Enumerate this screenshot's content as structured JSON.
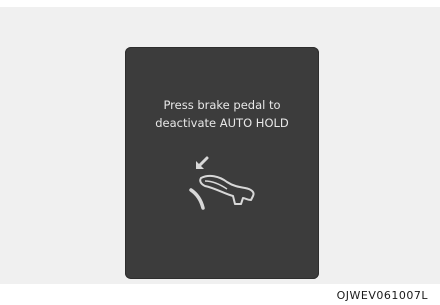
{
  "display": {
    "message_line1": "Press brake pedal to",
    "message_line2": "deactivate AUTO HOLD",
    "icon": "foot-pressing-brake-pedal-icon",
    "background_color": "#3c3c3c",
    "text_color": "#e8e8e8"
  },
  "figure": {
    "code": "OJWEV061007L"
  }
}
